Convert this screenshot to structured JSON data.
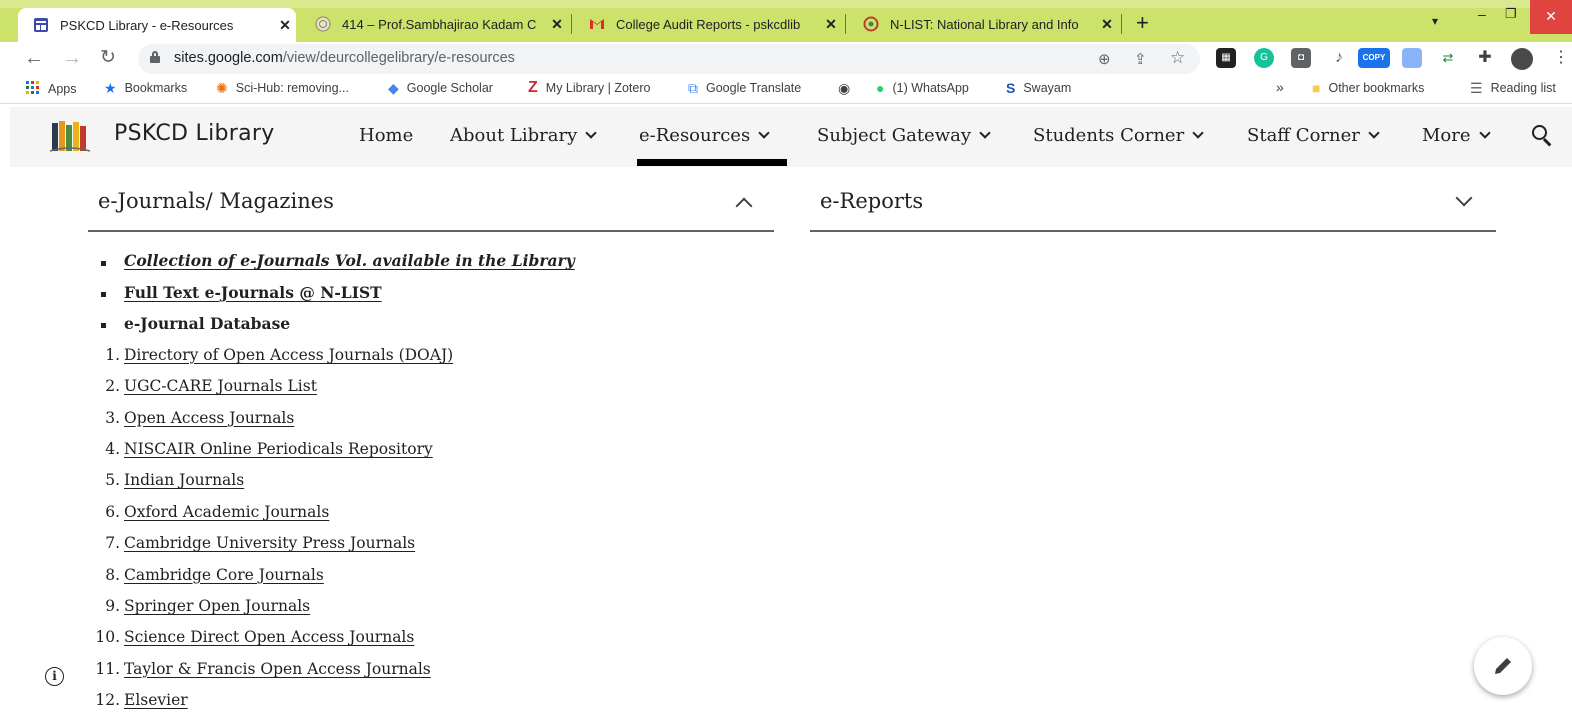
{
  "browser": {
    "tabs": [
      {
        "title": "PSKCD Library - e-Resources",
        "active": true,
        "icon": "sites-icon"
      },
      {
        "title": "414 – Prof.Sambhajirao Kadam C",
        "active": false,
        "icon": "college-seal-icon"
      },
      {
        "title": "College Audit Reports - pskcdlib",
        "active": false,
        "icon": "gmail-icon"
      },
      {
        "title": "N-LIST: National Library and Info",
        "active": false,
        "icon": "nlist-icon"
      }
    ],
    "url_host": "sites.google.com",
    "url_path": "/view/deurcollegelibrary/e-resources",
    "bookmarks": [
      {
        "label": "Apps",
        "icon": "apps-grid-icon"
      },
      {
        "label": "Bookmarks",
        "icon": "star-icon"
      },
      {
        "label": "Sci-Hub: removing...",
        "icon": "scihub-icon"
      },
      {
        "label": "Google Scholar",
        "icon": "scholar-icon"
      },
      {
        "label": "My Library | Zotero",
        "icon": "zotero-icon"
      },
      {
        "label": "Google Translate",
        "icon": "translate-icon"
      },
      {
        "label": "",
        "icon": "globe-icon"
      },
      {
        "label": "(1) WhatsApp",
        "icon": "whatsapp-icon"
      },
      {
        "label": "Swayam",
        "icon": "swayam-icon"
      }
    ],
    "overflow_label": "»",
    "other_bookmarks": "Other bookmarks",
    "reading_list": "Reading list",
    "extension_copy_label": "COPY"
  },
  "site": {
    "title": "PSKCD Library",
    "nav": [
      {
        "label": "Home",
        "dropdown": false,
        "active": false
      },
      {
        "label": "About Library",
        "dropdown": true,
        "active": false
      },
      {
        "label": "e-Resources",
        "dropdown": true,
        "active": true
      },
      {
        "label": "Subject Gateway",
        "dropdown": true,
        "active": false
      },
      {
        "label": "Students Corner",
        "dropdown": true,
        "active": false
      },
      {
        "label": "Staff Corner",
        "dropdown": true,
        "active": false
      },
      {
        "label": "More",
        "dropdown": true,
        "active": false
      }
    ]
  },
  "accordions": [
    {
      "title": "e-Journals/ Magazines",
      "expanded": true
    },
    {
      "title": "e-Reports",
      "expanded": false
    }
  ],
  "bullets": [
    {
      "text": "Collection of e-Journals Vol. available in the Library",
      "style": "bold-italic-link"
    },
    {
      "text": "Full Text e-Journals @ N-LIST",
      "style": "bold-link"
    },
    {
      "text": "e-Journal Database",
      "style": "bold"
    }
  ],
  "journals": [
    {
      "num": "1.",
      "text": "Directory of Open Access Journals (DOAJ)"
    },
    {
      "num": "2.",
      "text": "UGC-CARE Journals List"
    },
    {
      "num": "3.",
      "text": "Open Access Journals"
    },
    {
      "num": "4.",
      "text": "NISCAIR Online Periodicals Repository"
    },
    {
      "num": "5.",
      "text": "Indian Journals"
    },
    {
      "num": "6.",
      "text": "Oxford Academic Journals"
    },
    {
      "num": "7.",
      "text": "Cambridge University Press Journals"
    },
    {
      "num": "8.",
      "text": "Cambridge Core Journals"
    },
    {
      "num": "9.",
      "text": "Springer Open Journals"
    },
    {
      "num": "10.",
      "text": "Science Direct Open Access Journals"
    },
    {
      "num": "11.",
      "text": "Taylor & Francis Open Access Journals"
    },
    {
      "num": "12.",
      "text": "Elsevier"
    }
  ],
  "colors": {
    "tabbar": "#cde26a",
    "active_underline": "#000000",
    "close_window": "#e0443e"
  }
}
